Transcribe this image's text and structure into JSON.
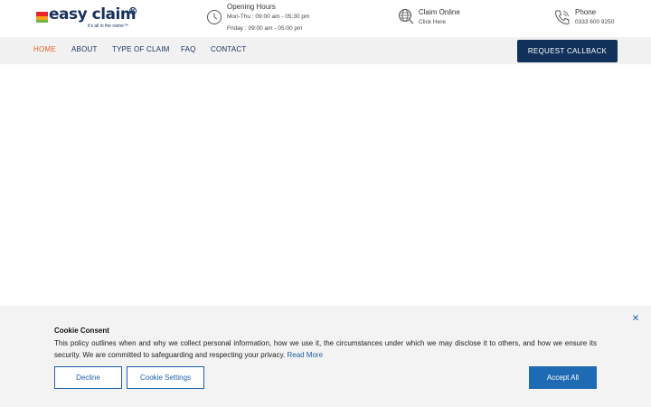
{
  "brand": {
    "name": "easy claim",
    "tagline": "it's all in the name™",
    "registered": "R",
    "colors": {
      "navy": "#17315c",
      "red": "#e8232a",
      "orange": "#f6a01a",
      "green": "#6fb444"
    }
  },
  "header": {
    "hours": {
      "icon": "clock-icon",
      "title": "Opening Hours",
      "line1": "Mon-Thu : 09:00 am - 05:30 pm",
      "line2": "Friday : 09:00 am - 05:00 pm"
    },
    "claim": {
      "icon": "globe-icon",
      "title": "Claim Online",
      "link": "Click Here"
    },
    "phone": {
      "icon": "phone-icon",
      "title": "Phone",
      "number": "0333 600 9250"
    }
  },
  "nav": {
    "items": [
      {
        "label": "HOME",
        "active": true
      },
      {
        "label": "ABOUT",
        "active": false
      },
      {
        "label": "TYPE OF CLAIM",
        "active": false
      },
      {
        "label": "FAQ",
        "active": false
      },
      {
        "label": "CONTACT",
        "active": false
      }
    ],
    "cta": "REQUEST CALLBACK",
    "active_color": "#e8632a",
    "cta_color": "#11305a"
  },
  "cookie": {
    "title": "Cookie Consent",
    "body": "This policy outlines when and why we collect personal information, how we use it, the circumstances under which we may disclose it to others, and how we ensure its security. We are committed to safeguarding and respecting your privacy.",
    "read_more": "Read More",
    "decline": "Decline",
    "settings": "Cookie Settings",
    "accept": "Accept All",
    "close_icon": "close-icon",
    "close_glyph": "✕",
    "accent": "#1f6bb3"
  }
}
